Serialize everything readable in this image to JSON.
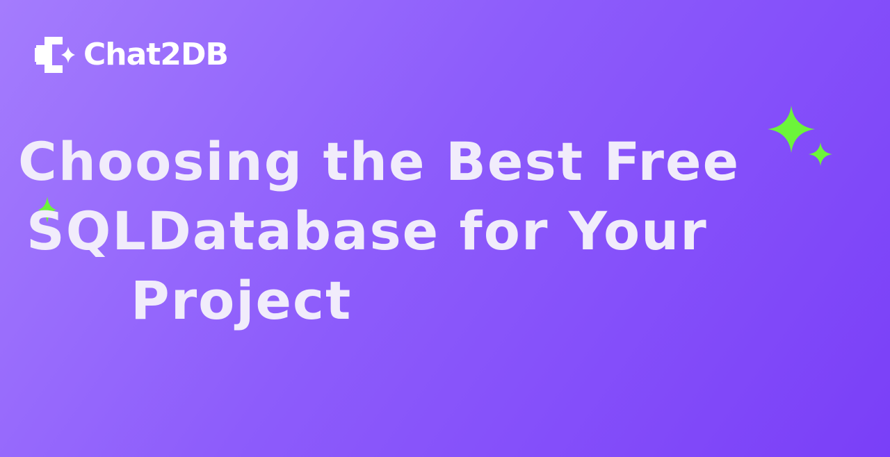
{
  "brand": {
    "name": "Chat2DB",
    "logo_icon": "chat2db-logo-icon",
    "logo_color": "#ffffff"
  },
  "headline": {
    "lines": [
      "Choosing the Best Free",
      "SQLDatabase for Your",
      "Project"
    ],
    "text_color": "#f1ecfb"
  },
  "decorations": {
    "sparkle_icon": "sparkle-icon",
    "sparkle_color": "#6cf53a"
  },
  "background": {
    "gradient_start": "#a47cfd",
    "gradient_end": "#7a3ff8"
  }
}
